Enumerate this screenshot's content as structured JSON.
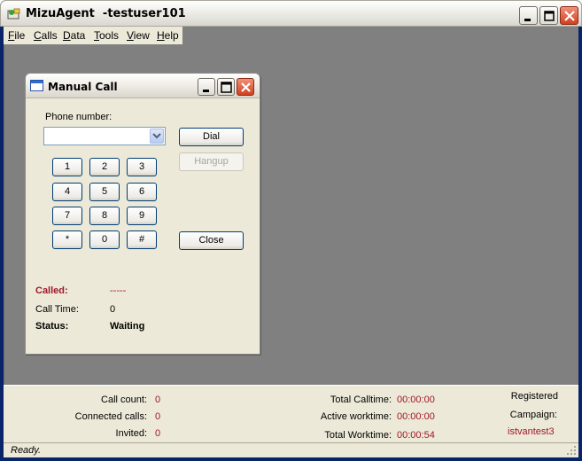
{
  "window": {
    "title": "MizuAgent  -testuser101"
  },
  "menu": {
    "items": [
      {
        "label": "File",
        "u": "F",
        "rest": "ile"
      },
      {
        "label": "Calls",
        "u": "C",
        "rest": "alls"
      },
      {
        "label": "Data",
        "u": "D",
        "rest": "ata"
      },
      {
        "label": "Tools",
        "u": "T",
        "rest": "ools"
      },
      {
        "label": "View",
        "u": "V",
        "rest": "iew"
      },
      {
        "label": "Help",
        "u": "H",
        "rest": "elp"
      }
    ]
  },
  "dialog": {
    "title": "Manual Call",
    "phone_label": "Phone number:",
    "phone_value": "",
    "dial_label": "Dial",
    "hangup_label": "Hangup",
    "close_label": "Close",
    "keypad": [
      "1",
      "2",
      "3",
      "4",
      "5",
      "6",
      "7",
      "8",
      "9",
      "*",
      "0",
      "#"
    ],
    "called_label": "Called:",
    "called_value": "-----",
    "calltime_label": "Call Time:",
    "calltime_value": "0",
    "status_label": "Status:",
    "status_value": "Waiting"
  },
  "stats": {
    "call_count_label": "Call count:",
    "call_count_value": "0",
    "connected_label": "Connected calls:",
    "connected_value": "0",
    "invited_label": "Invited:",
    "invited_value": "0",
    "total_calltime_label": "Total Calltime:",
    "total_calltime_value": "00:00:00",
    "active_worktime_label": "Active worktime:",
    "active_worktime_value": "00:00:00",
    "total_worktime_label": "Total Worktime:",
    "total_worktime_value": "00:00:54",
    "registered_label": "Registered",
    "campaign_label": "Campaign:",
    "campaign_value": "istvantest3"
  },
  "statusbar": {
    "text": "Ready."
  },
  "colors": {
    "accent_red": "#a0172b",
    "workspace": "#808080",
    "face": "#ece9d8"
  }
}
